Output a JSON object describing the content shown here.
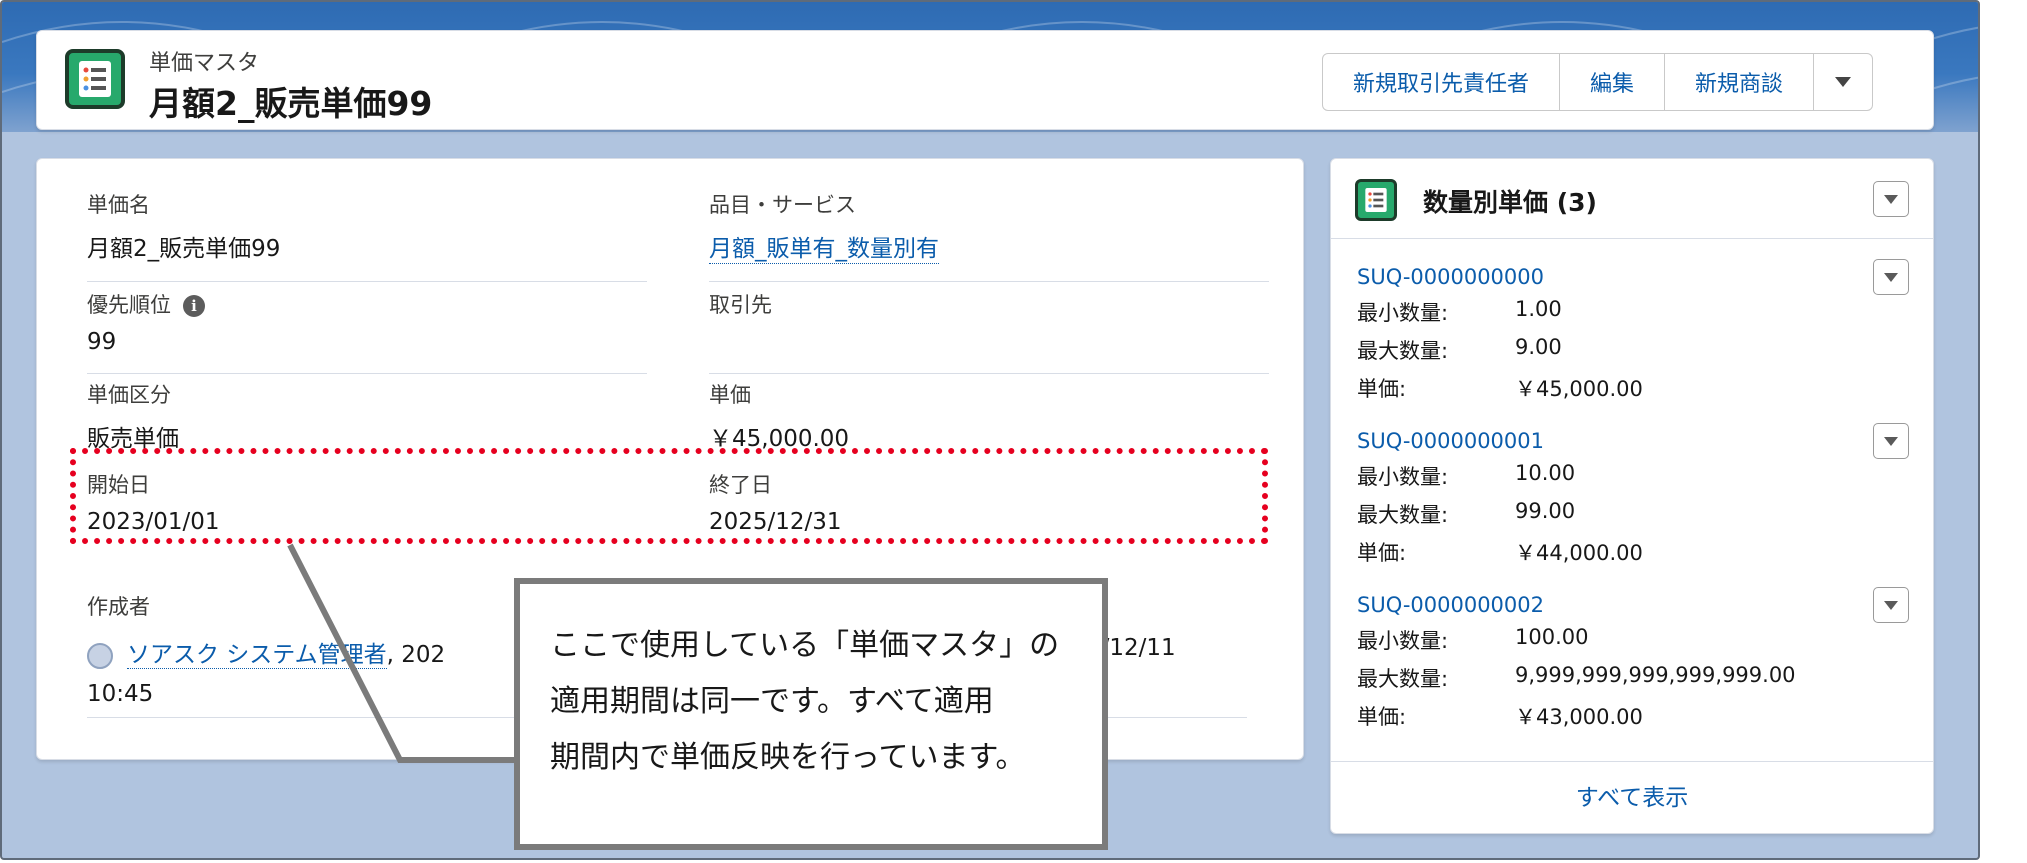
{
  "header": {
    "object_type": "単価マスタ",
    "record_name": "月額2_販売単価99",
    "buttons": [
      "新規取引先責任者",
      "編集",
      "新規商談"
    ]
  },
  "details": {
    "fields": [
      {
        "label": "単価名",
        "value": "月額2_販売単価99"
      },
      {
        "label": "品目・サービス",
        "value": "月額_販単有_数量別有"
      },
      {
        "label": "優先順位",
        "value": "99"
      },
      {
        "label": "取引先",
        "value": ""
      },
      {
        "label": "単価区分",
        "value": "販売単価"
      },
      {
        "label": "単価",
        "value": "￥45,000.00"
      },
      {
        "label": "開始日",
        "value": "2023/01/01"
      },
      {
        "label": "終了日",
        "value": "2025/12/31"
      }
    ],
    "created_by": {
      "label": "作成者",
      "user": "ソアスク システム管理者",
      "date_part": ", 202",
      "time": "10:45",
      "right_fragment": "3/12/11"
    },
    "info_icon_glyph": "i"
  },
  "callout": {
    "lines": [
      "ここで使用している「単価マスタ」の",
      "適用期間は同一です。すべて適用",
      "期間内で単価反映を行っています。"
    ]
  },
  "related": {
    "title": "数量別単価 (3)",
    "labels": {
      "min": "最小数量:",
      "max": "最大数量:",
      "price": "単価:"
    },
    "records": [
      {
        "code": "SUQ-0000000000",
        "min": "1.00",
        "max": "9.00",
        "price": "￥45,000.00"
      },
      {
        "code": "SUQ-0000000001",
        "min": "10.00",
        "max": "99.00",
        "price": "￥44,000.00"
      },
      {
        "code": "SUQ-0000000002",
        "min": "100.00",
        "max": "9,999,999,999,999,999.00",
        "price": "￥43,000.00"
      }
    ],
    "view_all": "すべて表示"
  },
  "colors": {
    "link": "#0b5cab",
    "icon_green": "#27a96c",
    "highlight_red": "#e6001f",
    "banner_blue": "#2e6bb3"
  },
  "icons": [
    "list-object-icon",
    "info-icon",
    "chevron-down-icon",
    "avatar-icon"
  ]
}
